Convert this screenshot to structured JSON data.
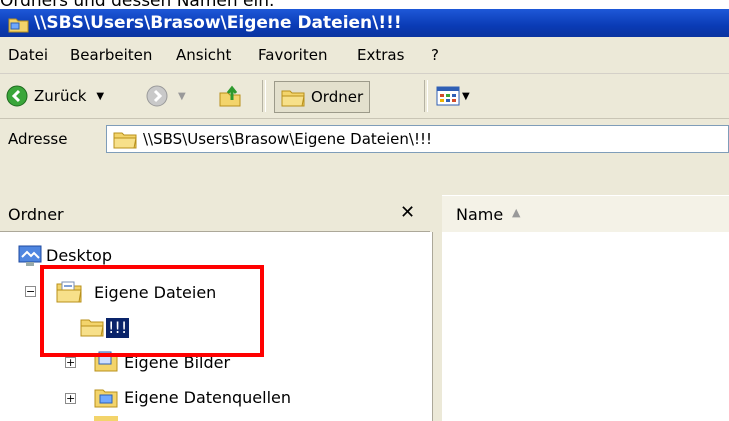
{
  "caption": "Ordners und dessen Namen ein.",
  "window": {
    "title": "\\\\SBS\\Users\\Brasow\\Eigene Dateien\\!!!"
  },
  "menu": [
    "Datei",
    "Bearbeiten",
    "Ansicht",
    "Favoriten",
    "Extras",
    "?"
  ],
  "toolbar": {
    "back_label": "Zurück",
    "folders_label": "Ordner"
  },
  "address": {
    "label": "Adresse",
    "value": "\\\\SBS\\Users\\Brasow\\Eigene Dateien\\!!!"
  },
  "folders_pane": {
    "title": "Ordner",
    "close_glyph": "✕"
  },
  "tree": {
    "desktop": "Desktop",
    "eigene_dateien": "Eigene Dateien",
    "new_folder": "!!!",
    "eigene_bilder": "Eigene Bilder",
    "eigene_datenquellen": "Eigene Datenquellen"
  },
  "list": {
    "name_header": "Name"
  },
  "colors": {
    "titlebar": "#0a3bb5",
    "highlight": "#ff0000",
    "selection": "#0a246a"
  }
}
